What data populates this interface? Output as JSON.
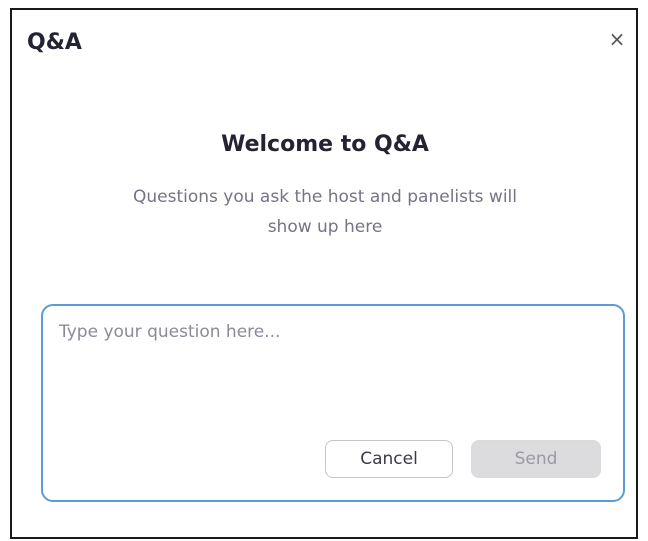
{
  "window": {
    "title": "Q&A",
    "close_glyph": "×"
  },
  "welcome": {
    "title": "Welcome to Q&A",
    "description_line1": "Questions you ask the host and panelists will",
    "description_line2": "show up here"
  },
  "question_input": {
    "placeholder": "Type your question here...",
    "value": ""
  },
  "buttons": {
    "cancel_label": "Cancel",
    "send_label": "Send",
    "send_enabled": false
  },
  "icons": {
    "close": "close-icon"
  },
  "colors": {
    "input_border": "#5d9ad8",
    "title_text": "#232333",
    "description_text": "#747487",
    "send_disabled_bg": "#dcdcdf"
  }
}
